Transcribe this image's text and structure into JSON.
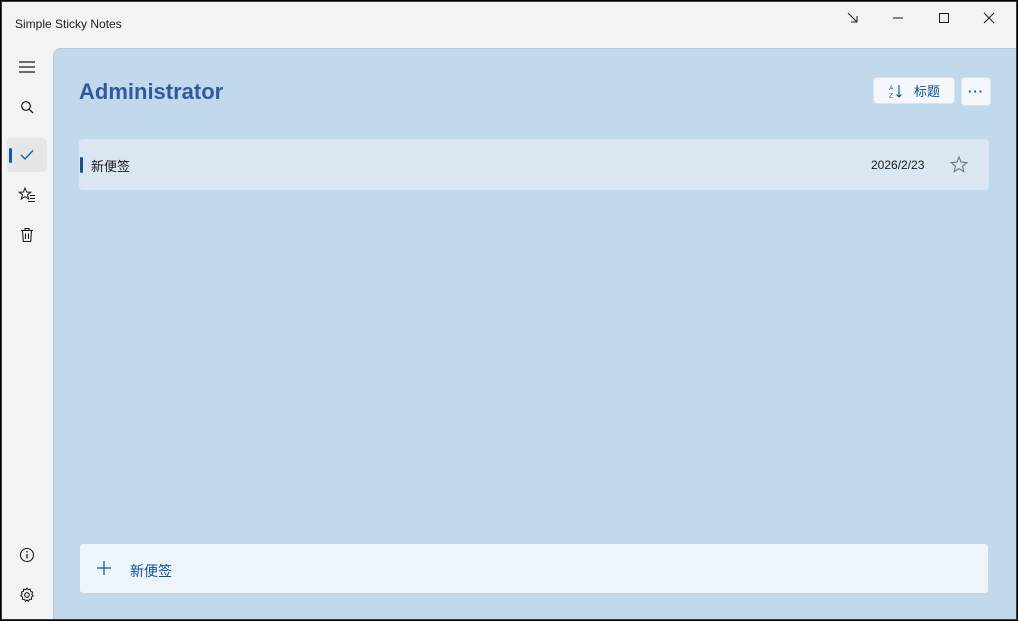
{
  "window": {
    "title": "Simple Sticky Notes"
  },
  "sidebar": {
    "items": [
      {
        "name": "menu-icon"
      },
      {
        "name": "search-icon"
      },
      {
        "name": "check-icon",
        "active": true
      },
      {
        "name": "starred-list-icon"
      },
      {
        "name": "trash-icon"
      }
    ],
    "bottom": [
      {
        "name": "info-icon"
      },
      {
        "name": "gear-icon"
      }
    ]
  },
  "main": {
    "title": "Administrator",
    "sort_label": "标题",
    "more_label": "···",
    "notes": [
      {
        "title": "新便签",
        "date": "2026/2/23",
        "starred": false
      }
    ],
    "new_note_label": "新便签"
  },
  "colors": {
    "accent": "#0a5aa5",
    "content_bg": "#c2d9ec",
    "title": "#2e5b9f"
  }
}
